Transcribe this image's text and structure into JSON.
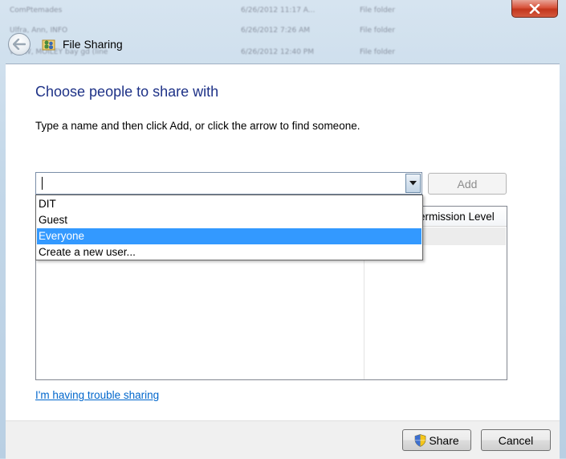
{
  "background_rows": [
    {
      "name": "ComPtemades",
      "date": "6/26/2012 11:17 A...",
      "type": "File folder"
    },
    {
      "name": "Ulfra, Ann, INFO",
      "date": "6/26/2012 7:26 AM",
      "type": "File folder"
    },
    {
      "name": "WWW, MOILEY bay gd (line",
      "date": "6/26/2012 12:40 PM",
      "type": "File folder"
    }
  ],
  "window": {
    "title": "File Sharing",
    "close_icon": "close-icon",
    "back_icon": "back-arrow-icon"
  },
  "main": {
    "heading": "Choose people to share with",
    "instruction": "Type a name and then click Add, or click the arrow to find someone.",
    "combo": {
      "value": "",
      "placeholder": ""
    },
    "add_label": "Add",
    "dropdown_items": [
      {
        "label": "DIT",
        "selected": false
      },
      {
        "label": "Guest",
        "selected": false
      },
      {
        "label": "Everyone",
        "selected": true
      },
      {
        "label": "Create a new user...",
        "selected": false
      }
    ],
    "list_header": "Permission Level",
    "trouble_link": "I'm having trouble sharing"
  },
  "footer": {
    "share_label": "Share",
    "cancel_label": "Cancel",
    "shield_icon": "uac-shield-icon"
  },
  "colors": {
    "heading": "#1e3287",
    "link": "#0066cc",
    "selection": "#3399ff"
  }
}
